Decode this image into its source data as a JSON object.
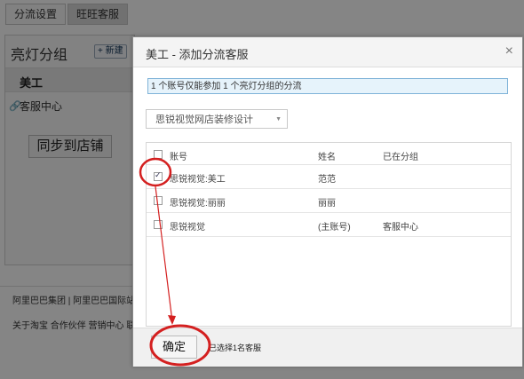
{
  "top_tabs": {
    "diversion_settings": "分流设置",
    "wangwang_service": "旺旺客服"
  },
  "left_panel": {
    "title": "亮灯分组",
    "new_button": "+ 新建",
    "active_item": "美工",
    "item": "客服中心",
    "sync_button": "同步到店铺"
  },
  "footer": {
    "line1": "阿里巴巴集团 | 阿里巴巴国际站",
    "line2": "关于淘宝  合作伙伴  营销中心  联"
  },
  "modal": {
    "title": "美工 - 添加分流客服",
    "close": "×",
    "notice": "1 个账号仅能参加 1 个亮灯分组的分流",
    "store_select": "思锐视觉网店装修设计",
    "table": {
      "headers": {
        "account": "账号",
        "name": "姓名",
        "group": "已在分组"
      },
      "rows": [
        {
          "account": "思锐视觉:美工",
          "name": "范范",
          "group": "",
          "checked": true
        },
        {
          "account": "思锐视觉:丽丽",
          "name": "丽丽",
          "group": "",
          "checked": false
        },
        {
          "account": "思锐视觉",
          "name": "(主账号)",
          "group": "客服中心",
          "checked": false
        }
      ]
    },
    "confirm_button": "确定",
    "selected_text": "已选择1名客服"
  },
  "colors": {
    "annotation_red": "#d42020",
    "notice_border": "#7fb3d8"
  }
}
